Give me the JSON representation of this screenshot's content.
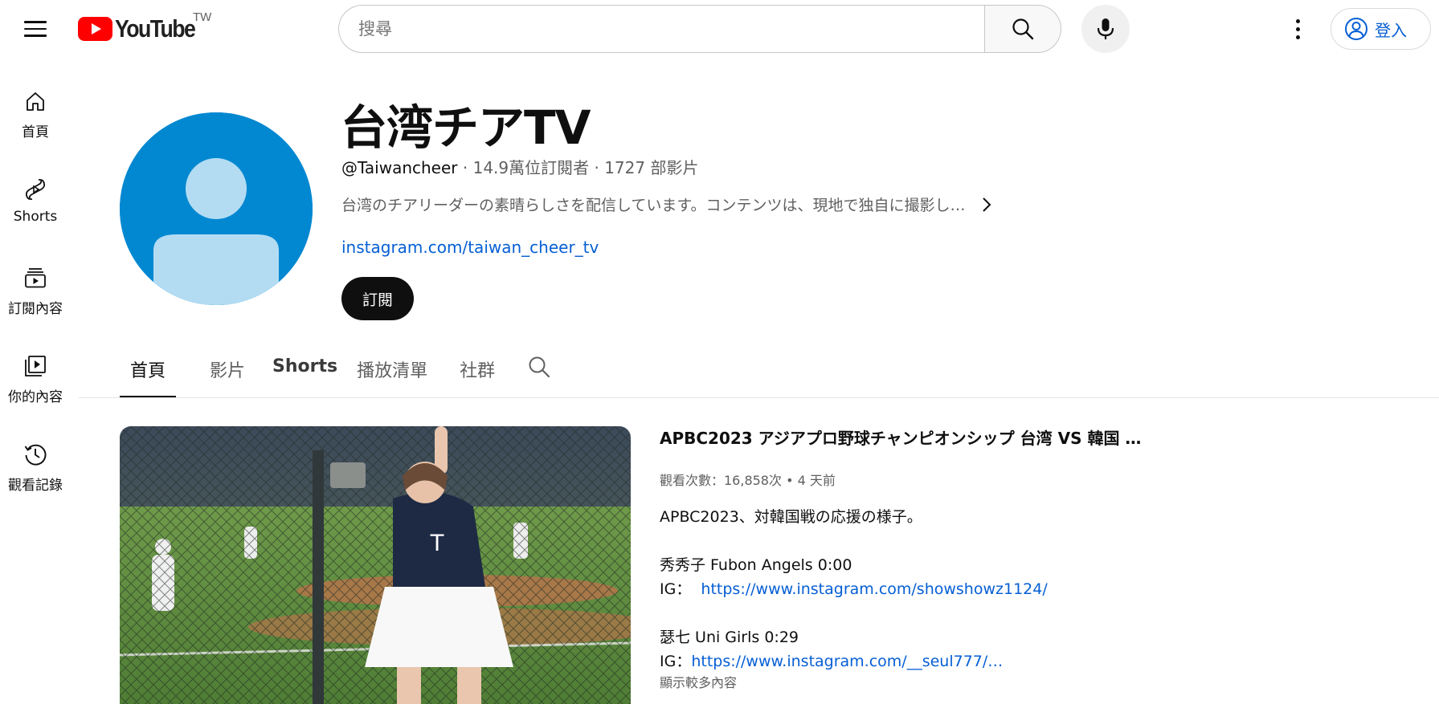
{
  "header": {
    "logo_text": "YouTube",
    "country_code": "TW",
    "search_placeholder": "搜尋",
    "signin_label": "登入"
  },
  "sidebar": {
    "items": [
      {
        "label": "首頁",
        "icon": "home-icon"
      },
      {
        "label": "Shorts",
        "icon": "shorts-icon"
      },
      {
        "label": "訂閱內容",
        "icon": "subscriptions-icon"
      },
      {
        "label": "你的內容",
        "icon": "library-icon"
      },
      {
        "label": "觀看記錄",
        "icon": "history-icon"
      }
    ]
  },
  "channel": {
    "name": "台湾チアTV",
    "handle": "@Taiwancheer",
    "subscribers": "14.9萬位訂閱者",
    "video_count": "1727 部影片",
    "description": "台湾のチアリーダーの素晴らしさを配信しています。コンテンツは、現地で独自に撮影し…",
    "link": "instagram.com/taiwan_cheer_tv",
    "subscribe_label": "訂閱",
    "avatar_color": "#0288d1"
  },
  "tabs": [
    {
      "label": "首頁",
      "active": true
    },
    {
      "label": "影片",
      "active": false
    },
    {
      "label": "Shorts",
      "active": false
    },
    {
      "label": "播放清單",
      "active": false
    },
    {
      "label": "社群",
      "active": false
    }
  ],
  "featured_video": {
    "title": "APBC2023 アジアプロ野球チャンピオンシップ 台湾 VS 韓国 …",
    "views": "觀看次數：16,858次",
    "age": "4 天前",
    "desc_line1": "APBC2023、対韓国戦の応援の様子。",
    "desc_line2": "秀秀子 Fubon Angels 0:00",
    "desc_line3_prefix": "IG：",
    "desc_line3_link": "https://www.instagram.com/showshowz1124/",
    "desc_line4": "瑟七 Uni Girls 0:29",
    "desc_line5_prefix": "IG：",
    "desc_line5_link": "https://www.instagram.com/__seul777/…",
    "show_more": "顯示較多內容"
  },
  "colors": {
    "accent_link": "#065fd4",
    "youtube_red": "#ff0000",
    "text_primary": "#0f0f0f",
    "text_secondary": "#606060"
  }
}
